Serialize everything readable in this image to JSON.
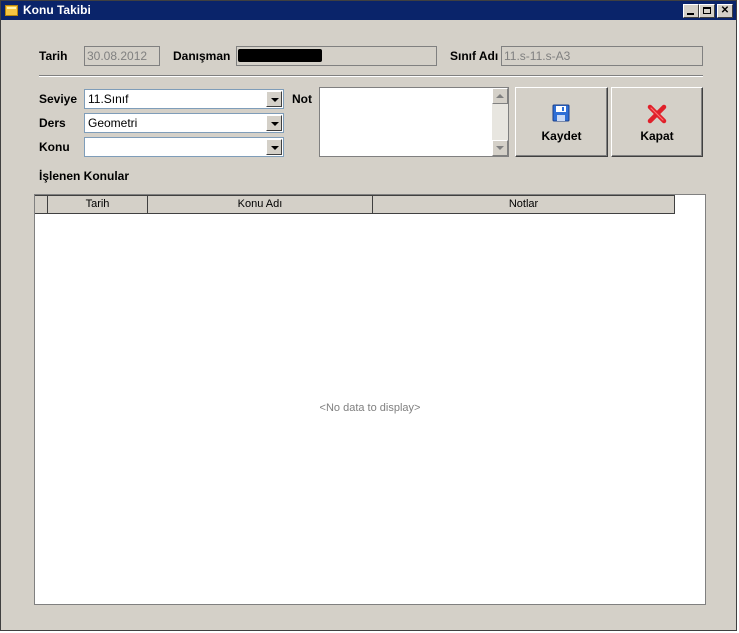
{
  "window": {
    "title": "Konu Takibi"
  },
  "header": {
    "tarih_label": "Tarih",
    "tarih_value": "30.08.2012",
    "danisman_label": "Danışman",
    "sinif_label": "Sınıf Adı",
    "sinif_value": "11.s-11.s-A3"
  },
  "form": {
    "seviye_label": "Seviye",
    "seviye_value": "11.Sınıf",
    "ders_label": "Ders",
    "ders_value": "Geometri",
    "konu_label": "Konu",
    "konu_value": "",
    "not_label": "Not",
    "not_value": ""
  },
  "buttons": {
    "kaydet": "Kaydet",
    "kapat": "Kapat"
  },
  "grid": {
    "section_title": "İşlenen Konular",
    "columns": [
      "Tarih",
      "Konu Adı",
      "Notlar"
    ],
    "rows": [],
    "empty_text": "<No data to display>"
  },
  "colors": {
    "title_bar": "#0a246a",
    "window_bg": "#d4d0c8",
    "close_icon": "#e0202a",
    "save_icon": "#2f6fd6"
  },
  "icons": {
    "app": "folder-icon",
    "save": "floppy-disk-icon",
    "close": "red-x-icon"
  }
}
